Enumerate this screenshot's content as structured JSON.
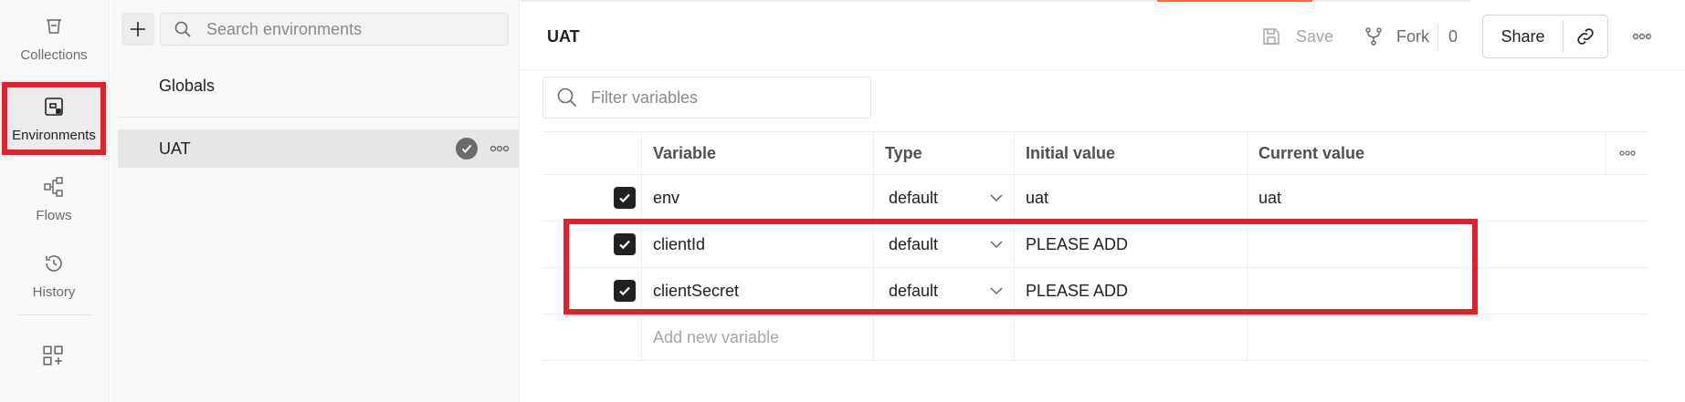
{
  "sidebar": {
    "items": [
      {
        "label": "Collections",
        "icon": "collections-icon"
      },
      {
        "label": "Environments",
        "icon": "environments-icon",
        "active": true
      },
      {
        "label": "Flows",
        "icon": "flows-icon"
      },
      {
        "label": "History",
        "icon": "history-icon"
      }
    ],
    "apps_icon": "add-workspace-icon"
  },
  "env_panel": {
    "search_placeholder": "Search environments",
    "globals_label": "Globals",
    "environments": [
      {
        "name": "UAT",
        "active": true
      }
    ]
  },
  "header": {
    "title": "UAT",
    "save_label": "Save",
    "fork_label": "Fork",
    "fork_count": "0",
    "share_label": "Share"
  },
  "filter": {
    "placeholder": "Filter variables"
  },
  "table": {
    "columns": [
      "Variable",
      "Type",
      "Initial value",
      "Current value"
    ],
    "rows": [
      {
        "checked": true,
        "variable": "env",
        "type": "default",
        "initial": "uat",
        "current": "uat"
      },
      {
        "checked": true,
        "variable": "clientId",
        "type": "default",
        "initial": "PLEASE ADD",
        "current": ""
      },
      {
        "checked": true,
        "variable": "clientSecret",
        "type": "default",
        "initial": "PLEASE ADD",
        "current": ""
      }
    ],
    "add_placeholder": "Add new variable"
  },
  "colors": {
    "highlight": "#e0202a",
    "accent": "#ff6c37",
    "sidebar_bg": "#f9f9f9"
  }
}
